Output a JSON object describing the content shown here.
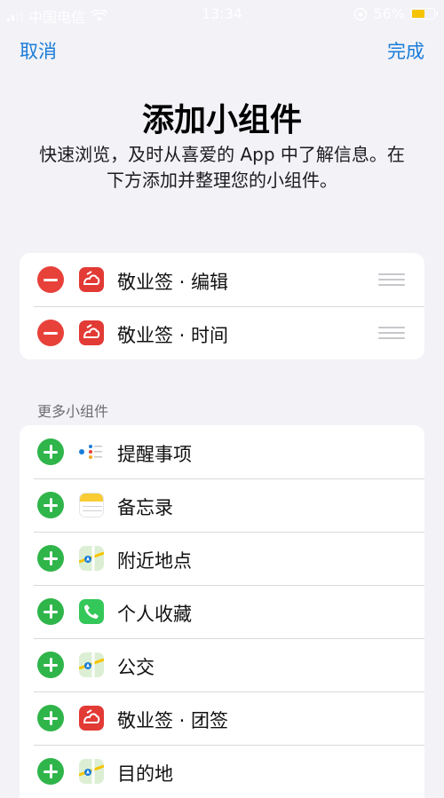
{
  "status_bar": {
    "carrier": "中国电信",
    "time": "13:34",
    "battery_percent": "56%"
  },
  "nav": {
    "cancel": "取消",
    "done": "完成"
  },
  "header": {
    "title": "添加小组件",
    "subtitle": "快速浏览，及时从喜爱的 App 中了解信息。在下方添加并整理您的小组件。"
  },
  "current_widgets": [
    {
      "label": "敬业签 · 编辑",
      "icon": "jingyeqian-icon"
    },
    {
      "label": "敬业签 · 时间",
      "icon": "jingyeqian-icon"
    }
  ],
  "more_widgets": {
    "header": "更多小组件",
    "items": [
      {
        "label": "提醒事项",
        "icon": "reminders-icon"
      },
      {
        "label": "备忘录",
        "icon": "notes-icon"
      },
      {
        "label": "附近地点",
        "icon": "maps-icon"
      },
      {
        "label": "个人收藏",
        "icon": "phone-icon"
      },
      {
        "label": "公交",
        "icon": "maps-icon"
      },
      {
        "label": "敬业签 · 团签",
        "icon": "jingyeqian-icon"
      },
      {
        "label": "目的地",
        "icon": "maps-icon"
      }
    ]
  },
  "colors": {
    "accent": "#1a7cd8",
    "remove": "#e8413a",
    "add": "#2fb54a",
    "background": "#f2f2f7"
  }
}
